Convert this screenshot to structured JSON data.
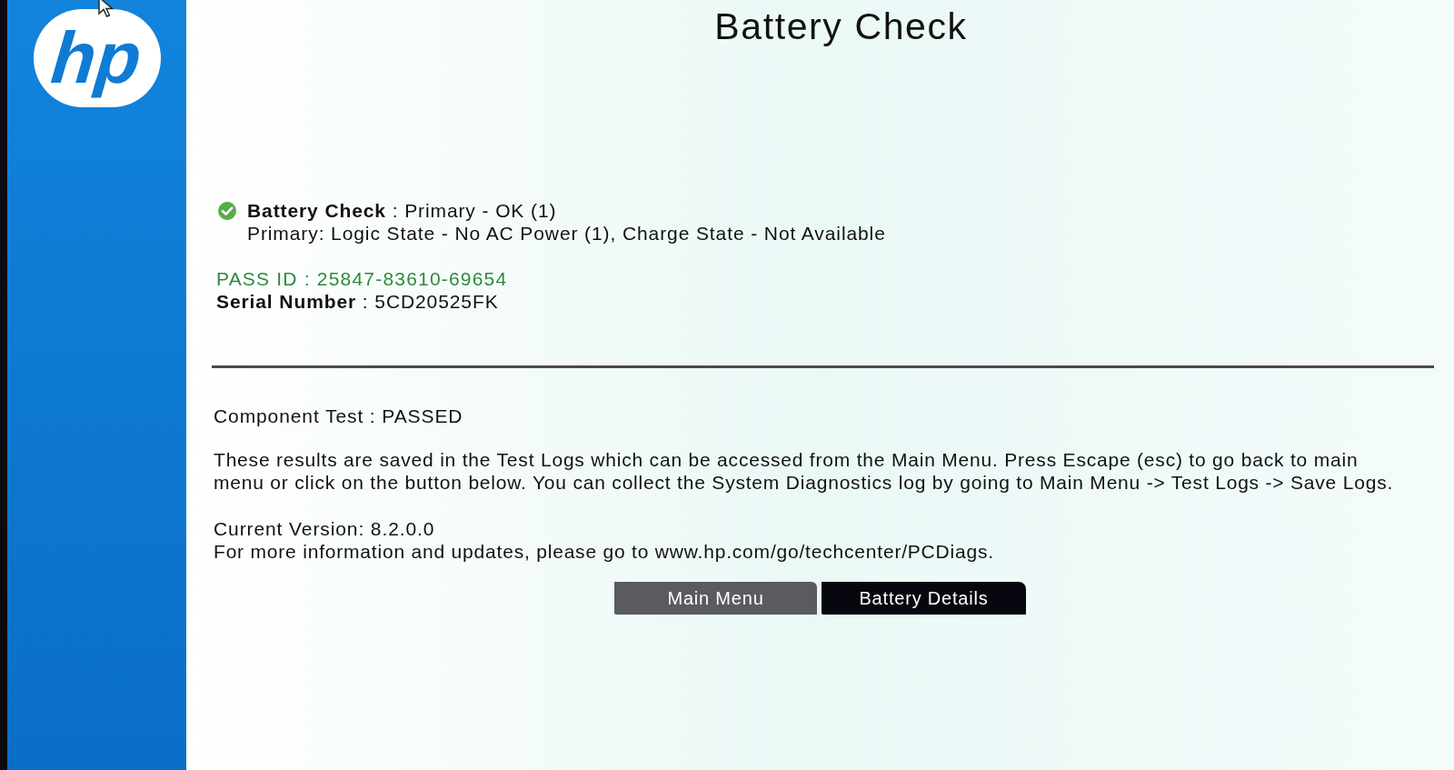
{
  "sidebar": {
    "logo_text": "hp"
  },
  "title": "Battery Check",
  "result": {
    "passed": true,
    "summary": "**Battery Check** : Primary - OK (1)",
    "detail": "Primary: Logic State - No AC Power (1), Charge State - Not Available"
  },
  "pass_id": "PASS ID : 25847-83610-69654",
  "serial_number": "**Serial Number** : 5CD20525FK",
  "component_test": "Component Test : PASSED",
  "message": "These results are saved in the Test Logs which can be accessed from the Main Menu. Press Escape (esc) to go back to main menu or click on the button below. You can collect the System Diagnostics log by going to Main Menu -> Test Logs -> Save Logs.",
  "current_version": "Current Version: 8.2.0.0",
  "more_info": "For more information and updates, please go to www.hp.com/go/techcenter/PCDiags.",
  "buttons": [
    {
      "label": "Main Menu",
      "selected": false
    },
    {
      "label": "Battery Details",
      "selected": true
    }
  ]
}
